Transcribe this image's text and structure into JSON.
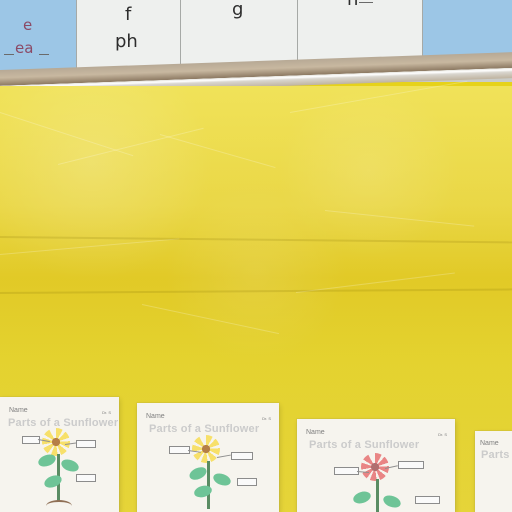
{
  "chart_strip": {
    "cards": [
      {
        "letter": "e",
        "subtext": "ea"
      },
      {
        "letter": "f",
        "subtext": "ph"
      },
      {
        "letter": "g",
        "subtext": ""
      },
      {
        "letter": "n",
        "subtext": ""
      }
    ]
  },
  "worksheets": [
    {
      "title": "Parts of a Sunflower"
    },
    {
      "title": "Parts of a Sunflower"
    },
    {
      "title": "Parts of a Sunflower"
    },
    {
      "title": "Parts"
    }
  ]
}
